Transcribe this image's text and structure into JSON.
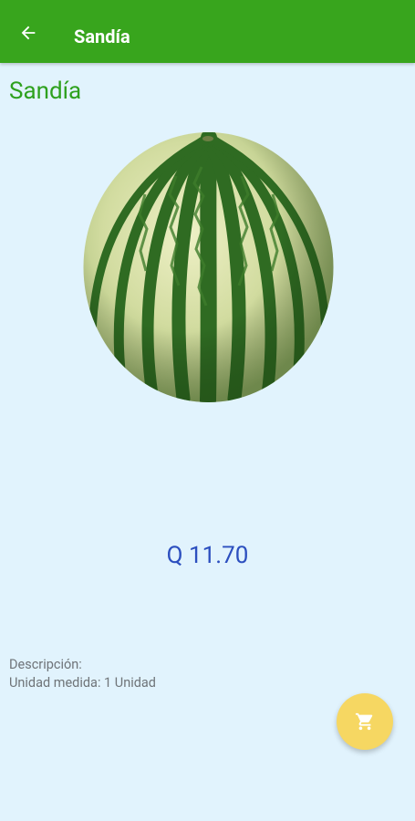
{
  "appbar": {
    "title": "Sandía",
    "back_icon": "arrow-back-icon"
  },
  "product": {
    "name": "Sandía",
    "image": "watermelon-image",
    "price": "Q 11.70",
    "description_label": "Descripción:",
    "unit_line": "Unidad medida: 1 Unidad"
  },
  "fab": {
    "icon": "shopping-cart-icon"
  },
  "colors": {
    "appbar": "#38a51d",
    "background": "#e1f3fd",
    "title_green": "#2ea11e",
    "price_blue": "#2c4fbf",
    "fab_yellow": "#f6d762"
  }
}
